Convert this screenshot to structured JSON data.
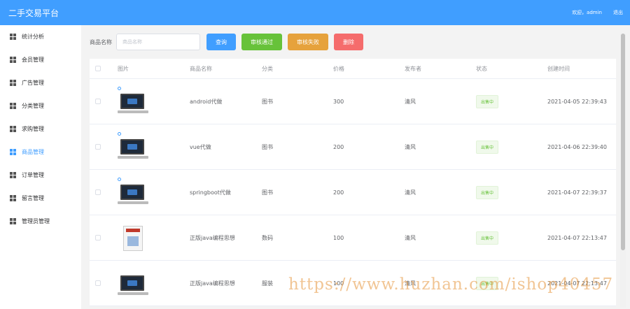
{
  "header": {
    "title": "二手交易平台",
    "welcome": "欢迎，admin",
    "logout": "退出"
  },
  "sidebar": {
    "items": [
      {
        "label": "统计分析"
      },
      {
        "label": "会员管理"
      },
      {
        "label": "广告管理"
      },
      {
        "label": "分类管理"
      },
      {
        "label": "求购管理"
      },
      {
        "label": "商品管理"
      },
      {
        "label": "订单管理"
      },
      {
        "label": "留言管理"
      },
      {
        "label": "管理员管理"
      }
    ],
    "active_index": 5
  },
  "toolbar": {
    "label": "商品名称",
    "placeholder": "商品名称",
    "value": "",
    "search": "查询",
    "approve": "审核通过",
    "reject": "审核失败",
    "delete": "删除"
  },
  "table": {
    "headers": [
      "图片",
      "商品名称",
      "分类",
      "价格",
      "发布者",
      "状态",
      "创建时间"
    ],
    "rows": [
      {
        "image": "desktop-computer",
        "name": "android代做",
        "category": "图书",
        "price": "300",
        "publisher": "清风",
        "status": "出售中",
        "created": "2021-04-05 22:39:43"
      },
      {
        "image": "laptop",
        "name": "vue代做",
        "category": "图书",
        "price": "200",
        "publisher": "清风",
        "status": "出售中",
        "created": "2021-04-06 22:39:40"
      },
      {
        "image": "laptop",
        "name": "springboot代做",
        "category": "图书",
        "price": "200",
        "publisher": "清风",
        "status": "出售中",
        "created": "2021-04-07 22:39:37"
      },
      {
        "image": "book",
        "name": "正版java编程思想",
        "category": "数码",
        "price": "100",
        "publisher": "清风",
        "status": "出售中",
        "created": "2021-04-07 22:13:47"
      },
      {
        "image": "laptop",
        "name": "正版java编程思想",
        "category": "服装",
        "price": "100",
        "publisher": "清风",
        "status": "出售中",
        "created": "2021-04-07 22:13:47"
      }
    ]
  },
  "watermark": "https://www.huzhan.com/ishop40457",
  "colors": {
    "primary": "#409eff",
    "success": "#67c23a",
    "warning": "#e6a23c",
    "danger": "#f56c6c"
  }
}
